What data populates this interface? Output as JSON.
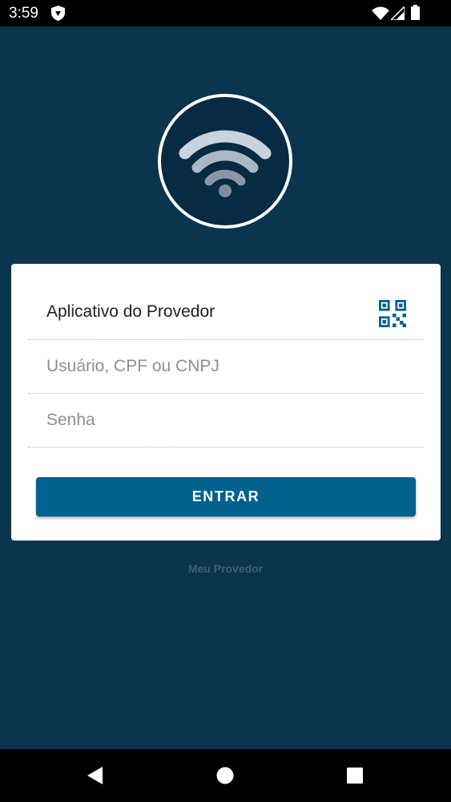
{
  "status_bar": {
    "time": "3:59",
    "icons": [
      "shield-icon",
      "wifi-icon",
      "signal-icon",
      "battery-icon"
    ]
  },
  "logo": {
    "icon": "wifi-icon",
    "colors": {
      "circle_border": "#ffffff",
      "circle_fill": "#072b42",
      "wave_outer": "#c9d3db",
      "wave_middle": "#aab8c3",
      "wave_inner": "#8898a6",
      "dot": "#7d8d9b"
    }
  },
  "login": {
    "provider_name": "Aplicativo do Provedor",
    "qr_icon": "qr-code-icon",
    "user_placeholder": "Usuário, CPF ou CNPJ",
    "user_value": "",
    "password_placeholder": "Senha",
    "password_value": "",
    "submit_label": "ENTRAR"
  },
  "footer": {
    "link_text": "Meu Provedor"
  },
  "nav_bar": {
    "buttons": [
      "back-icon",
      "home-icon",
      "recents-icon"
    ]
  },
  "colors": {
    "background": "#0b344f",
    "primary": "#00618f",
    "card": "#ffffff",
    "footer_text": "#3a6078"
  }
}
